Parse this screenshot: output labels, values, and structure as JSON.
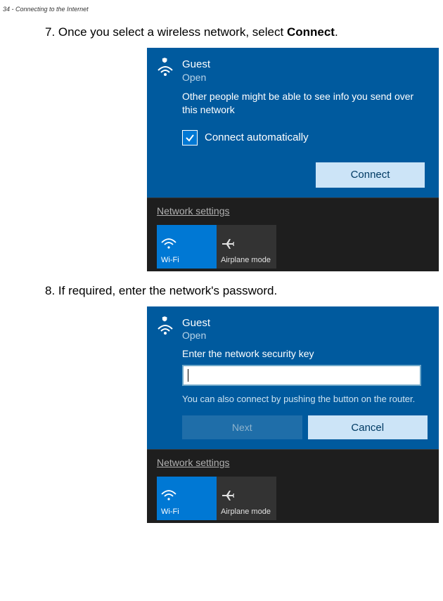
{
  "page": {
    "header": "34 - Connecting to the Internet"
  },
  "step7": {
    "text_prefix": "7. Once you select a wireless network, select ",
    "text_bold": "Connect",
    "text_suffix": "."
  },
  "step8": {
    "text": "8. If required, enter the network's password."
  },
  "flyout1": {
    "network_name": "Guest",
    "network_status": "Open",
    "warning": "Other people might be able to see info you send over this network",
    "checkbox_label": "Connect automatically",
    "connect_label": "Connect",
    "settings_label": "Network settings",
    "wifi_tile": "Wi-Fi",
    "airplane_tile": "Airplane mode"
  },
  "flyout2": {
    "network_name": "Guest",
    "network_status": "Open",
    "prompt": "Enter the network security key",
    "password_value": "",
    "hint": "You can also connect by pushing the button on the router.",
    "next_label": "Next",
    "cancel_label": "Cancel",
    "settings_label": "Network settings",
    "wifi_tile": "Wi-Fi",
    "airplane_tile": "Airplane mode"
  }
}
